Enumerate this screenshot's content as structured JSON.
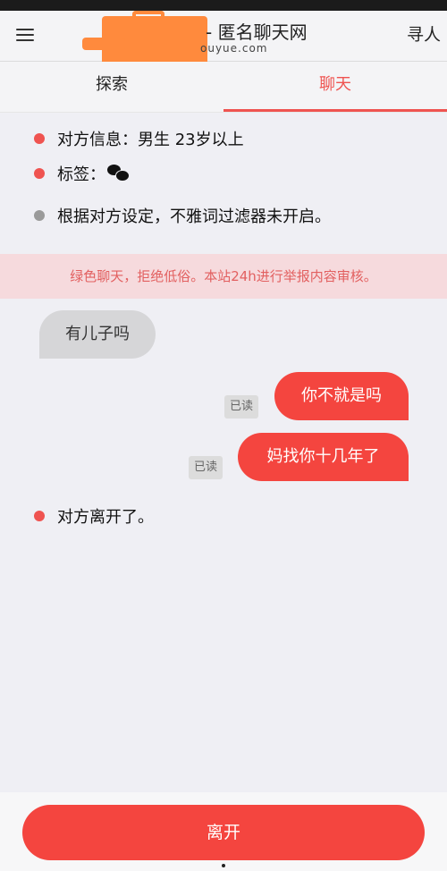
{
  "header": {
    "menu_icon": "hamburger-icon",
    "title": "- 匿名聊天网",
    "url": "ouyue.com",
    "find_label": "寻人"
  },
  "tabs": [
    {
      "label": "探索",
      "active": false
    },
    {
      "label": "聊天",
      "active": true
    }
  ],
  "info": {
    "partner_info": "对方信息：男生 23岁以上",
    "tags_label": "标签：",
    "tags_icon": "wechat-icon",
    "filter_notice": "根据对方设定，不雅词过滤器未开启。"
  },
  "notice": "绿色聊天，拒绝低俗。本站24h进行举报内容审核。",
  "messages": [
    {
      "side": "left",
      "text": "有儿子吗"
    },
    {
      "side": "right",
      "text": "你不就是吗",
      "status": "已读"
    },
    {
      "side": "right",
      "text": "妈找你十几年了",
      "status": "已读"
    }
  ],
  "left_notice": "对方离开了。",
  "leave_button": "离开",
  "colors": {
    "accent": "#ef5350",
    "bubble_right": "#f4453f",
    "bubble_left": "#d6d6d8",
    "notice_bg": "#f6dadd",
    "notice_text": "#e26060"
  }
}
